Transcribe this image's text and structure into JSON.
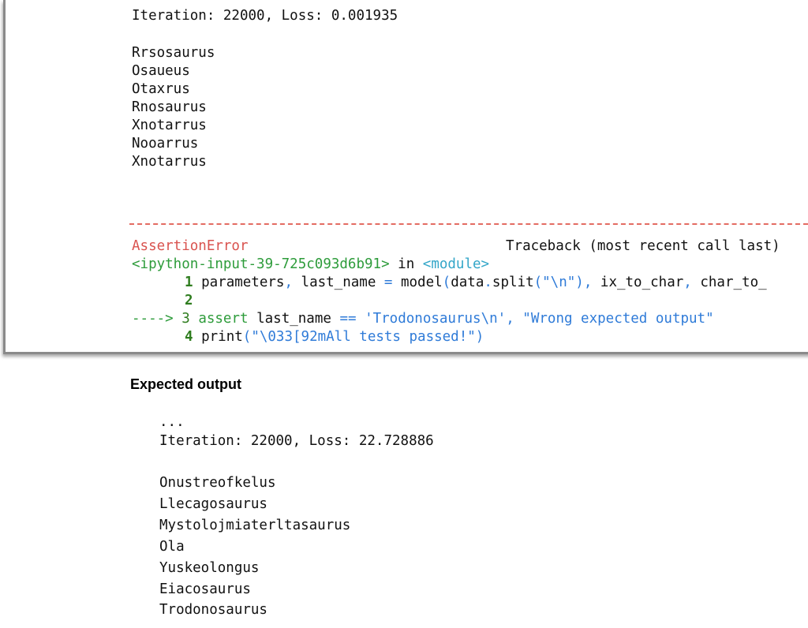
{
  "output": {
    "iteration_line": "Iteration: 22000, Loss: 0.001935",
    "names": [
      "Rrsosaurus",
      "Osaueus",
      "Otaxrus",
      "Rnosaurus",
      "Xnotarrus",
      "Nooarrus",
      "Xnotarrus"
    ]
  },
  "traceback": {
    "error_name": "AssertionError",
    "traceback_label": "Traceback (most recent call last)",
    "input_ref": "<ipython-input-39-725c093d6b91>",
    "in_word": " in ",
    "module_ref": "<module>",
    "lines": [
      {
        "num": "1",
        "arrow": "",
        "code": "parameters, last_name = model(data.split(\"\\n\"), ix_to_char, char_to_"
      },
      {
        "num": "2",
        "arrow": "",
        "code": ""
      },
      {
        "num": "3",
        "arrow": "---->",
        "code": "assert last_name == 'Trodonosaurus\\n', \"Wrong expected output\""
      },
      {
        "num": "4",
        "arrow": "",
        "code": "print(\"\\033[92mAll tests passed!\")"
      }
    ]
  },
  "expected": {
    "heading": "Expected output",
    "ellipsis": "...",
    "iteration_line": "Iteration: 22000, Loss: 22.728886",
    "names": [
      "Onustreofkelus",
      "Llecagosaurus",
      "Mystolojmiaterltasaurus",
      "Ola",
      "Yuskeolongus",
      "Eiacosaurus",
      "Trodonosaurus"
    ]
  }
}
